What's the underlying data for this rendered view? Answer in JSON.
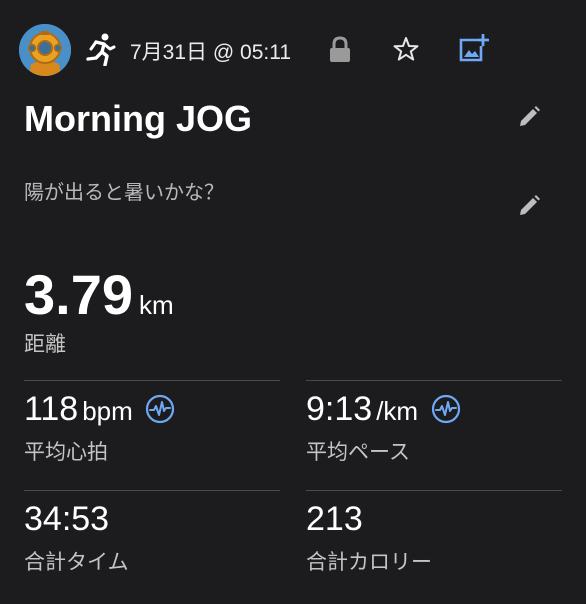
{
  "header": {
    "activity_icon": "running-person-icon",
    "date_time": "7月31日 @ 05:11",
    "lock_icon": "lock-icon",
    "star_icon": "star-outline-icon",
    "photo_icon": "add-photo-icon",
    "accent_color": "#6fa8f5"
  },
  "activity": {
    "title": "Morning JOG",
    "description": "陽が出ると暑いかな？"
  },
  "distance": {
    "value": "3.79",
    "unit": "km",
    "label": "距離"
  },
  "stats": {
    "heart_rate": {
      "value": "118",
      "unit": "bpm",
      "label": "平均心拍"
    },
    "pace": {
      "value": "9:13",
      "unit": "/km",
      "label": "平均ペース"
    },
    "time": {
      "value": "34:53",
      "label": "合計タイム"
    },
    "calories": {
      "value": "213",
      "label": "合計カロリー"
    }
  }
}
